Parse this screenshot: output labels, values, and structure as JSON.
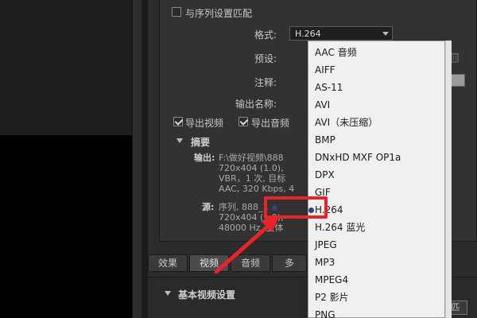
{
  "settings": {
    "match_sequence_label": "与序列设置匹配",
    "format_label": "格式:",
    "format_value": "H.264",
    "preset_label": "预设:",
    "comment_label": "注释:",
    "output_name_label": "输出名称:",
    "export_video_label": "导出视频",
    "export_audio_label": "导出音频"
  },
  "summary": {
    "title": "摘要",
    "output_label": "输出:",
    "output_lines": [
      "F:\\做好视频\\888",
      "720x404 (1.0),",
      "VBR，1 次, 目标",
      "AAC, 320 Kbps, 4"
    ],
    "source_label": "源:",
    "source_lines": [
      "序列, 888_1",
      "720x404 (1.0),",
      "48000 Hz, 立体"
    ]
  },
  "tabs": [
    "效果",
    "视频",
    "音频",
    "多"
  ],
  "basic_video": {
    "title": "基本视频设置",
    "button_label": "匹"
  },
  "dropdown": {
    "items": [
      "AAC 音频",
      "AIFF",
      "AS-11",
      "AVI",
      "AVI（未压缩）",
      "BMP",
      "DNxHD MXF OP1a",
      "DPX",
      "GIF",
      "H.264",
      "H.264 蓝光",
      "JPEG",
      "MP3",
      "MPEG4",
      "P2 影片",
      "PNG"
    ],
    "selected": "H.264"
  },
  "colors": {
    "highlight": "#e8242a",
    "panel": "#323232",
    "menu_bg": "#f0f0f0"
  },
  "icons": [
    "trash-icon",
    "checkbox-icon",
    "chevron-down-icon",
    "collapse-triangle-icon",
    "radio-dot-icon",
    "red-arrow-annotation"
  ]
}
